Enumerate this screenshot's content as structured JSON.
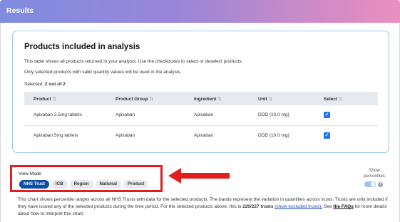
{
  "header": {
    "title": "Results"
  },
  "analysis": {
    "title": "Products included in analysis",
    "desc1": "This table shows all products returned in your analysis. Use the checkboxes to select or deselect products.",
    "desc2": "Only selected products with valid quantity values will be used in the analysis.",
    "selected_prefix": "Selected: ",
    "selected_value": "2 out of 2",
    "columns": [
      "Product",
      "Product Group",
      "Ingredient",
      "Unit",
      "Select"
    ],
    "rows": [
      {
        "product": "Apixaban 2.5mg tablets",
        "group": "Apixaban",
        "ingredient": "Apixaban",
        "unit": "DDD (10.0 mg)",
        "selected": true
      },
      {
        "product": "Apixaban 5mg tablets",
        "group": "Apixaban",
        "ingredient": "Apixaban",
        "unit": "DDD (10.0 mg)",
        "selected": true
      }
    ]
  },
  "view_mode": {
    "label": "View Mode",
    "options": [
      "NHS Trust",
      "ICB",
      "Region",
      "National",
      "Product"
    ],
    "active": "NHS Trust"
  },
  "percentiles": {
    "label_line1": "Show",
    "label_line2": "percentiles",
    "enabled": true
  },
  "explanation": {
    "text1": "This chart shows percentile ranges across all NHS Trusts with data for the selected products. The bands represent the variation in quantities across trusts. Trusts are only included if they have issued any of the selected products during the time period. For the selected products above, this is ",
    "trust_count": "220/227 trusts",
    "link_excluded": "(show excluded trusts).",
    "text2": " See ",
    "faq_link": "the FAQs",
    "text3": " for more details about how to interpret this chart."
  },
  "colors": {
    "accent": "#0b4fa6",
    "highlight_border": "#e01e1e",
    "arrow": "#e01e1e",
    "card_border": "#9cc7ec"
  },
  "icons": [
    "sort-icon",
    "checkbox-checked-icon",
    "info-icon",
    "red-arrow-annotation"
  ]
}
